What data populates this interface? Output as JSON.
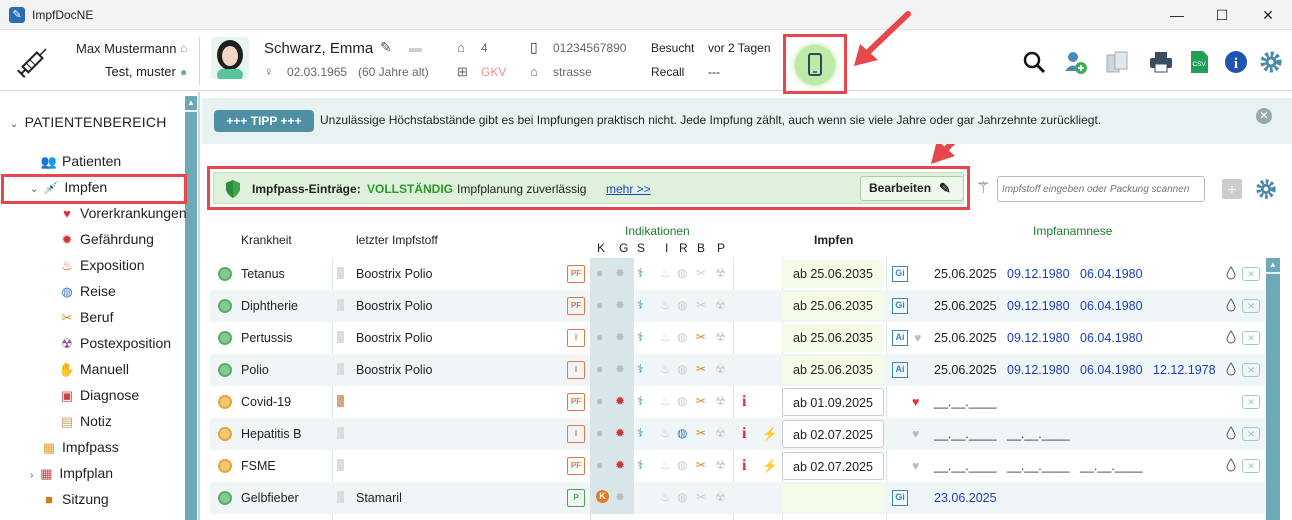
{
  "window": {
    "title": "ImpfDocNE",
    "minimize": "—",
    "maximize": "☐",
    "close": "✕"
  },
  "header": {
    "user_name": "Max Mustermann",
    "practice": "Test, muster",
    "patient_name": "Schwarz, Emma",
    "birth_date": "02.03.1965",
    "age": "(60 Jahre alt)",
    "tag_count": "4",
    "insurance": "GKV",
    "phone": "01234567890",
    "street": "strasse",
    "visited_label": "Besucht",
    "visited_value": "vor 2 Tagen",
    "recall_label": "Recall",
    "recall_value": "---"
  },
  "sidebar": {
    "section": "PATIENTENBEREICH",
    "items": [
      {
        "label": "Patienten",
        "icon": "patients-icon"
      },
      {
        "label": "Impfen",
        "icon": "syringe-icon"
      },
      {
        "label": "Vorerkrankungen",
        "icon": "heart-icon"
      },
      {
        "label": "Gefährdung",
        "icon": "virus-icon"
      },
      {
        "label": "Exposition",
        "icon": "flame-icon"
      },
      {
        "label": "Reise",
        "icon": "globe-icon"
      },
      {
        "label": "Beruf",
        "icon": "tools-icon"
      },
      {
        "label": "Postexposition",
        "icon": "bite-icon"
      },
      {
        "label": "Manuell",
        "icon": "hand-icon"
      },
      {
        "label": "Diagnose",
        "icon": "diagnosis-icon"
      },
      {
        "label": "Notiz",
        "icon": "note-icon"
      },
      {
        "label": "Impfpass",
        "icon": "passport-icon"
      },
      {
        "label": "Impfplan",
        "icon": "calendar-icon"
      },
      {
        "label": "Sitzung",
        "icon": "briefcase-icon"
      }
    ]
  },
  "tip": {
    "badge": "+++ TIPP +++",
    "text": "Unzulässige Höchstabstände gibt es bei Impfungen praktisch nicht. Jede Impfung zählt, auch wenn sie viele Jahre oder gar Jahrzehnte zurückliegt."
  },
  "impfpass": {
    "label": "Impfpass-Einträge:",
    "status": "VOLLSTÄNDIG",
    "note": "Impfplanung zuverlässig",
    "more": "mehr >>",
    "edit": "Bearbeiten"
  },
  "search": {
    "placeholder": "Impfstoff eingeben oder Packung scannen"
  },
  "table": {
    "headers": {
      "disease": "Krankheit",
      "last_vaccine": "letzter Impfstoff",
      "indications": "Indikationen",
      "ind_letters": [
        "K",
        "G",
        "S",
        "I",
        "R",
        "B",
        "P"
      ],
      "impfen": "Impfen",
      "anamnese": "Impfanamnese"
    },
    "rows": [
      {
        "disease": "Tetanus",
        "vaccine": "Boostrix Polio",
        "doc": "PF",
        "impfen": "ab 25.06.2035",
        "gi": "Gi",
        "dates": [
          "25.06.2025",
          "09.12.1980",
          "06.04.1980"
        ]
      },
      {
        "disease": "Diphtherie",
        "vaccine": "Boostrix Polio",
        "doc": "PF",
        "impfen": "ab 25.06.2035",
        "gi": "Gi",
        "dates": [
          "25.06.2025",
          "09.12.1980",
          "06.04.1980"
        ]
      },
      {
        "disease": "Pertussis",
        "vaccine": "Boostrix Polio",
        "doc": "I",
        "impfen": "ab 25.06.2035",
        "gi": "Ai",
        "dates": [
          "25.06.2025",
          "09.12.1980",
          "06.04.1980"
        ]
      },
      {
        "disease": "Polio",
        "vaccine": "Boostrix Polio",
        "doc": "I",
        "impfen": "ab 25.06.2035",
        "gi": "Ai",
        "dates": [
          "25.06.2025",
          "09.12.1980",
          "06.04.1980",
          "12.12.1978"
        ]
      },
      {
        "disease": "Covid-19",
        "vaccine": "",
        "doc": "PF",
        "impfen": "ab 01.09.2025",
        "gi": "",
        "dates": [
          "__.__.____"
        ]
      },
      {
        "disease": "Hepatitis B",
        "vaccine": "",
        "doc": "I",
        "impfen": "ab 02.07.2025",
        "gi": "",
        "dates": [
          "__.__.____",
          "__.__.____"
        ]
      },
      {
        "disease": "FSME",
        "vaccine": "",
        "doc": "PF",
        "impfen": "ab 02.07.2025",
        "gi": "",
        "dates": [
          "__.__.____",
          "__.__.____",
          "__.__.____"
        ]
      },
      {
        "disease": "Gelbfieber",
        "vaccine": "Stamaril",
        "doc": "P",
        "impfen": "",
        "gi": "Gi",
        "dates": [
          "23.06.2025"
        ]
      }
    ]
  }
}
